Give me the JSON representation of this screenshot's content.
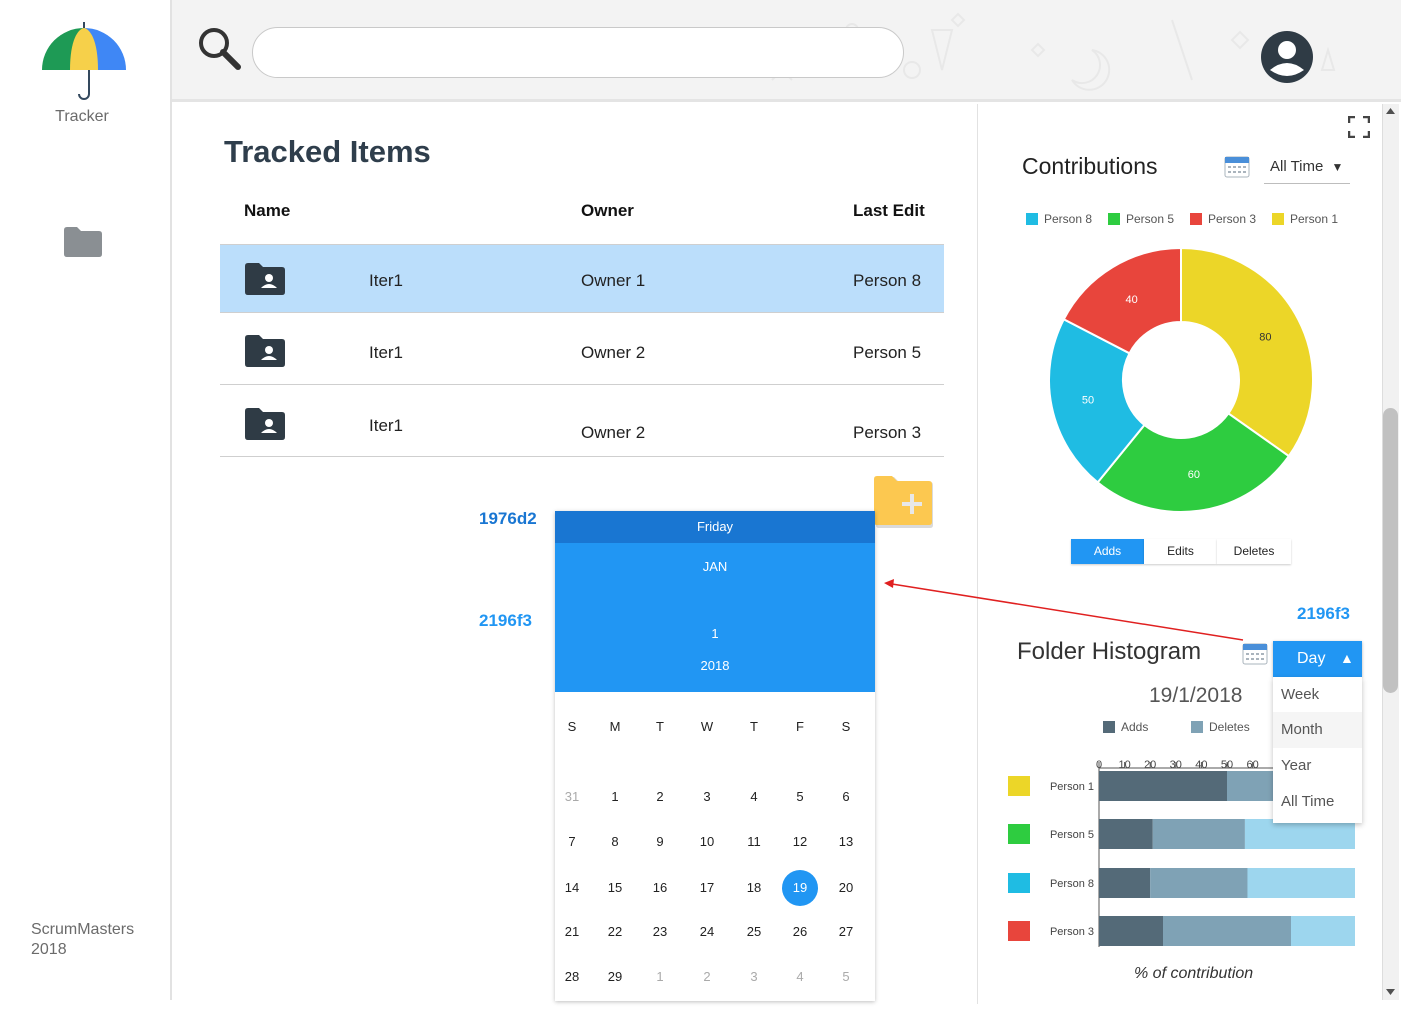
{
  "sidebar": {
    "app_name": "Tracker",
    "footer_line1": "ScrumMasters",
    "footer_line2": "2018"
  },
  "header": {
    "search": {
      "value": "",
      "placeholder": ""
    }
  },
  "tracked": {
    "title": "Tracked Items",
    "columns": [
      "Name",
      "Owner",
      "Last Edit"
    ],
    "rows": [
      {
        "name": "Iter1",
        "owner": "Owner 1",
        "last_edit": "Person 8",
        "selected": true
      },
      {
        "name": "Iter1",
        "owner": "Owner 2",
        "last_edit": "Person 5",
        "selected": false
      },
      {
        "name": "Iter1",
        "owner": "Owner 2",
        "last_edit": "Person 3",
        "selected": false
      }
    ]
  },
  "color_labels": {
    "header_color": "1976d2",
    "body_color": "2196f3",
    "dropdown_color": "2196f3"
  },
  "datepicker": {
    "weekday": "Friday",
    "month": "JAN",
    "day": "1",
    "year": "2018",
    "dow": [
      "S",
      "M",
      "T",
      "W",
      "T",
      "F",
      "S"
    ],
    "weeks": [
      [
        "31",
        "1",
        "2",
        "3",
        "4",
        "5",
        "6"
      ],
      [
        "7",
        "8",
        "9",
        "10",
        "11",
        "12",
        "13"
      ],
      [
        "14",
        "15",
        "16",
        "17",
        "18",
        "19",
        "20"
      ],
      [
        "21",
        "22",
        "23",
        "24",
        "25",
        "26",
        "27"
      ],
      [
        "28",
        "29",
        "1",
        "2",
        "3",
        "4",
        "5"
      ]
    ],
    "selected_date": "19",
    "header_color": "#1976d2",
    "body_color": "#2196f3"
  },
  "contributions": {
    "title": "Contributions",
    "range_select": "All Time",
    "legend": [
      {
        "name": "Person 8",
        "color": "#1fbce3"
      },
      {
        "name": "Person 5",
        "color": "#2ecc40"
      },
      {
        "name": "Person 3",
        "color": "#e8453c"
      },
      {
        "name": "Person 1",
        "color": "#ecd628"
      }
    ],
    "tabs": [
      "Adds",
      "Edits",
      "Deletes"
    ],
    "active_tab": "Adds"
  },
  "histogram": {
    "title": "Folder Histogram",
    "date": "19/1/2018",
    "legend_adds": "Adds",
    "legend_deletes": "Deletes",
    "xlabel": "% of contribution",
    "dropdown": {
      "selected": "Day",
      "options": [
        "Week",
        "Month",
        "Year",
        "All Time"
      ]
    }
  },
  "chart_data": [
    {
      "type": "pie",
      "title": "Contributions",
      "labels": [
        "Person 1",
        "Person 5",
        "Person 8",
        "Person 3"
      ],
      "values": [
        80,
        60,
        50,
        40
      ],
      "colors": [
        "#ecd628",
        "#2ecc40",
        "#1fbce3",
        "#e8453c"
      ]
    },
    {
      "type": "bar",
      "title": "Folder Histogram",
      "categories": [
        "Person 1",
        "Person 5",
        "Person 8",
        "Person 3"
      ],
      "category_colors": [
        "#ecd628",
        "#2ecc40",
        "#1fbce3",
        "#e8453c"
      ],
      "series": [
        {
          "name": "Adds",
          "values": [
            50,
            21,
            20,
            25
          ],
          "color": "#546a78"
        },
        {
          "name": "Deletes",
          "values": [
            25,
            36,
            38,
            50
          ],
          "color": "#7fa2b5"
        },
        {
          "values": [
            25,
            43,
            42,
            25
          ],
          "color": "#9dd6ee"
        }
      ],
      "xticks": [
        "0",
        "10",
        "20",
        "30",
        "40",
        "50",
        "60"
      ],
      "xlabel": "% of contribution",
      "stacked": true,
      "orientation": "horizontal"
    }
  ]
}
